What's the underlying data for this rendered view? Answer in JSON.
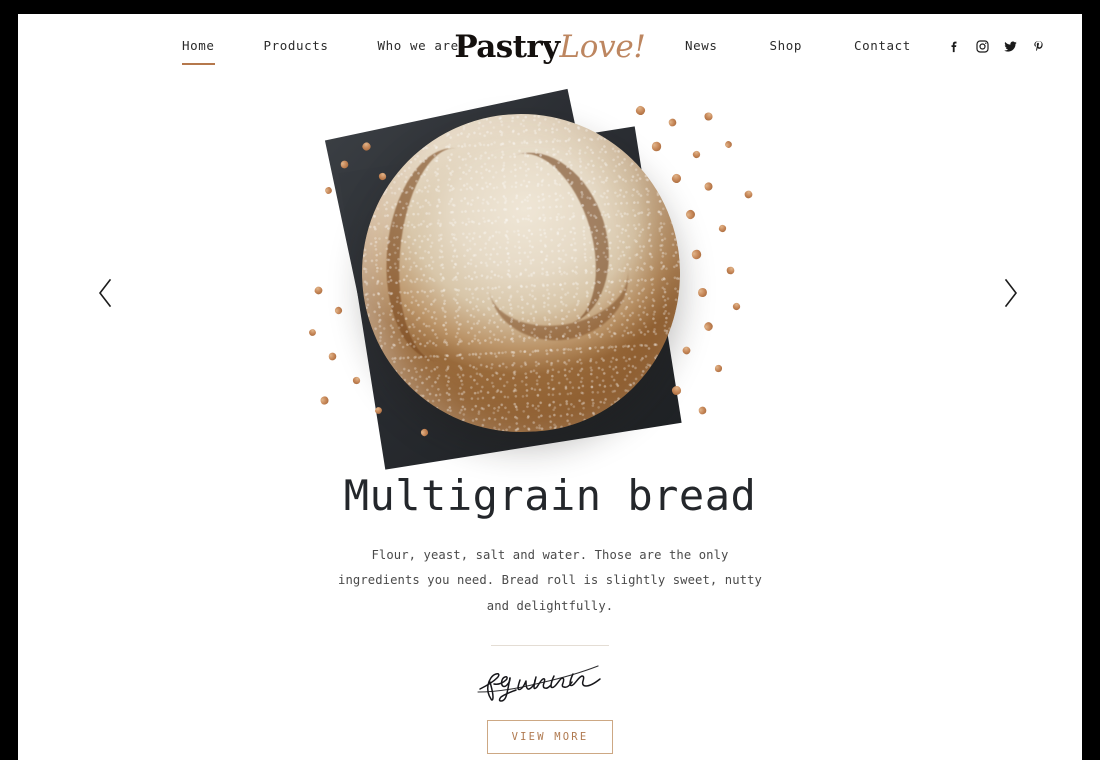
{
  "site": {
    "logo_primary": "Pastry",
    "logo_accent": "Love!",
    "accent_color": "#bd8660",
    "underline_color": "#b5784c",
    "button_color": "#b07a50",
    "slate_color": "#2c2f34"
  },
  "nav": {
    "left_items": [
      {
        "label": "Home",
        "active": true
      },
      {
        "label": "Products",
        "active": false
      },
      {
        "label": "Who we are",
        "active": false
      }
    ],
    "right_items": [
      {
        "label": "News",
        "active": false
      },
      {
        "label": "Shop",
        "active": false
      },
      {
        "label": "Contact",
        "active": false
      }
    ]
  },
  "social": [
    {
      "name": "facebook-icon",
      "label": "Facebook"
    },
    {
      "name": "instagram-icon",
      "label": "Instagram"
    },
    {
      "name": "twitter-icon",
      "label": "Twitter"
    },
    {
      "name": "pinterest-icon",
      "label": "Pinterest"
    }
  ],
  "slider": {
    "prev_label": "Previous slide",
    "next_label": "Next slide",
    "hero_alt": "Round multigrain bread loaf on a dark slate board with scattered buckwheat grains"
  },
  "slide": {
    "title": "Multigrain bread",
    "description": "Flour, yeast, salt and water. Those are the only ingredients you need. Bread roll is slightly sweet, nutty and delightfully.",
    "signature_label": "Signature",
    "cta_label": "VIEW MORE"
  }
}
